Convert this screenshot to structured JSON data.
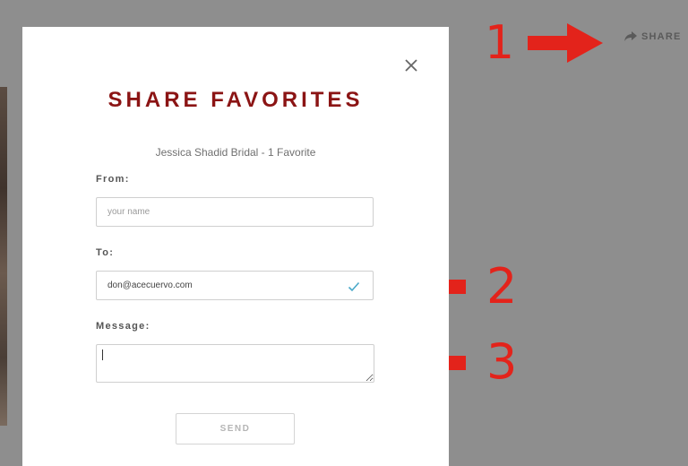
{
  "page": {
    "share_label": "SHARE"
  },
  "modal": {
    "title": "SHARE FAVORITES",
    "subtitle": "Jessica Shadid Bridal - 1 Favorite",
    "from_label": "From:",
    "from_placeholder": "your name",
    "from_value": "",
    "to_label": "To:",
    "to_value": "don@acecuervo.com",
    "message_label": "Message:",
    "message_value": "",
    "send_label": "SEND"
  },
  "annotations": {
    "marker_1": "1",
    "marker_2": "2",
    "marker_3": "3",
    "arrow_color": "#e3231b"
  },
  "colors": {
    "backdrop": "#8e8e8e",
    "title": "#8b1414",
    "check": "#4aa9c9"
  },
  "icons": {
    "share": "share-arrow-icon",
    "close": "close-icon",
    "valid": "checkmark-icon"
  }
}
